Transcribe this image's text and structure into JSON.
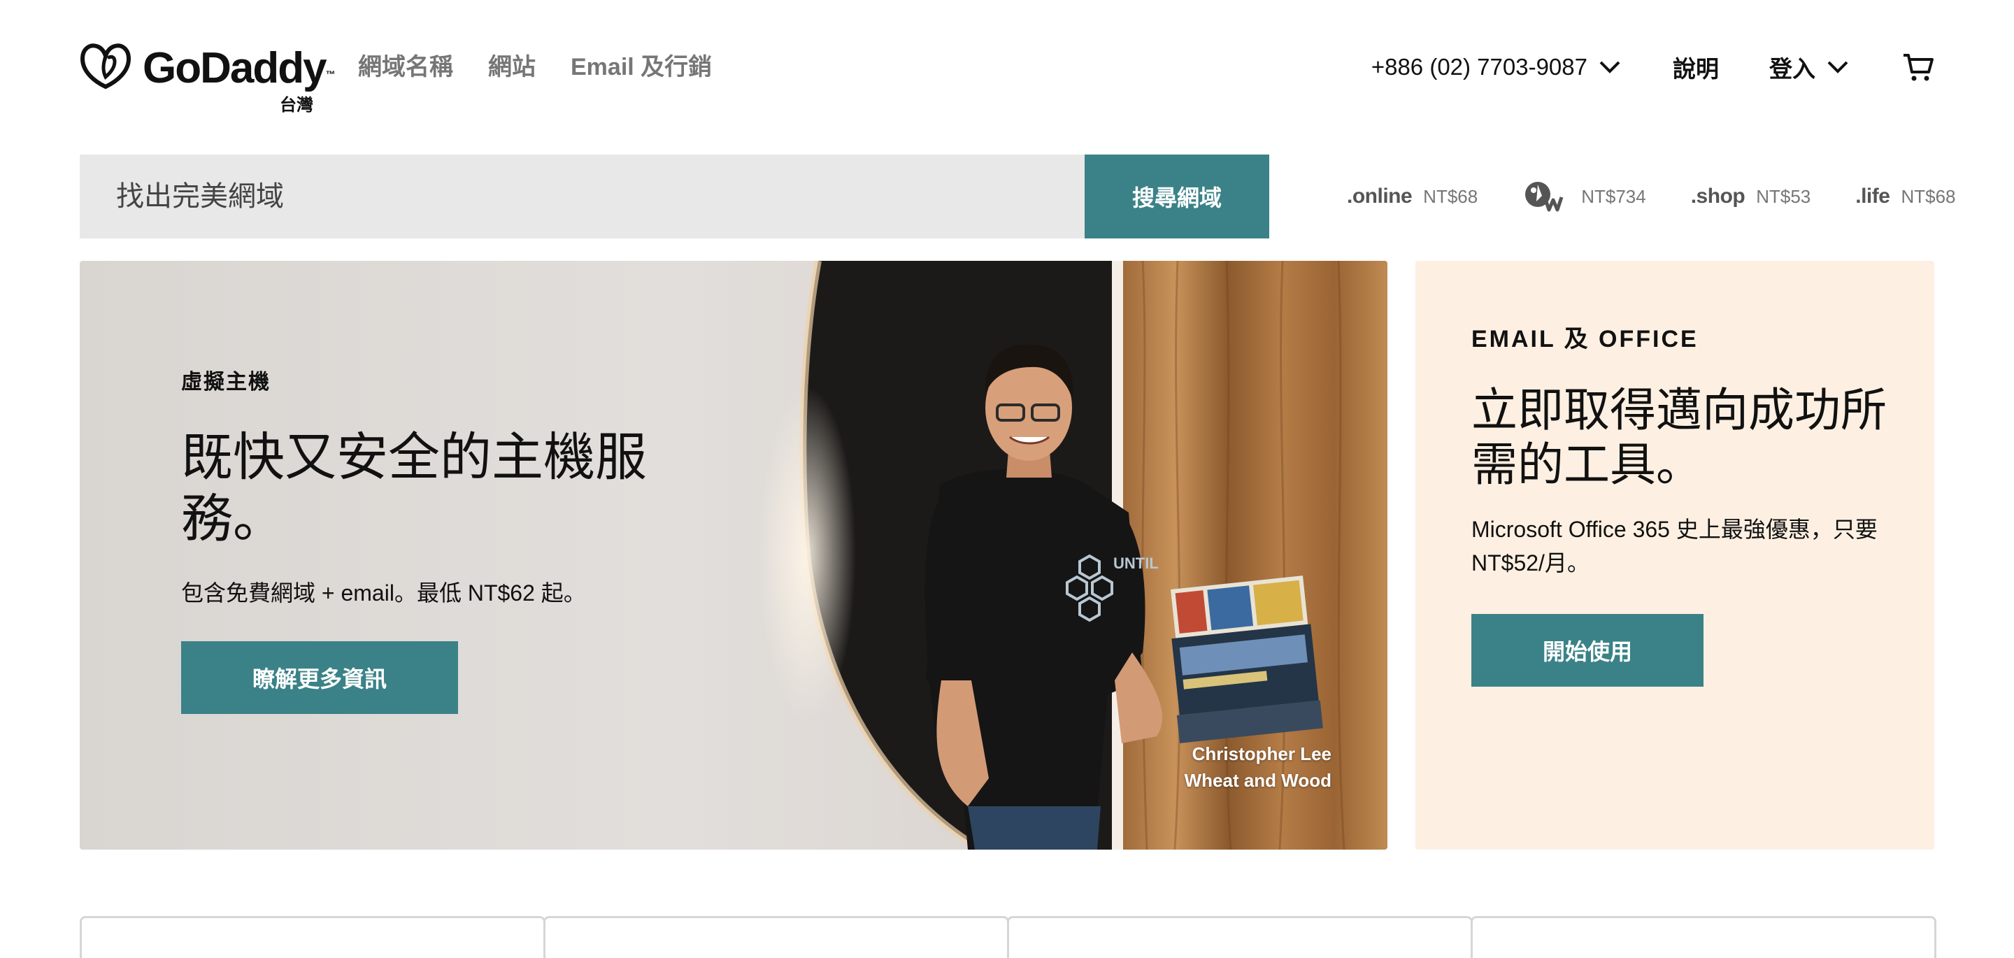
{
  "brand": {
    "name": "GoDaddy",
    "region": "台灣",
    "accent_color": "#3a8287"
  },
  "nav": {
    "items": [
      "網域名稱",
      "網站",
      "Email 及行銷"
    ]
  },
  "utility": {
    "phone": "+886 (02) 7703-9087",
    "help": "說明",
    "signin": "登入",
    "cart_icon": "cart-icon"
  },
  "search": {
    "placeholder": "找出完美網域",
    "button": "搜尋網域"
  },
  "tlds": [
    {
      "name": ".online",
      "price": "NT$68"
    },
    {
      "name": ".tw",
      "price": "NT$734"
    },
    {
      "name": ".shop",
      "price": "NT$53"
    },
    {
      "name": ".life",
      "price": "NT$68"
    }
  ],
  "hero": {
    "eyebrow": "虛擬主機",
    "title": "既快又安全的主機服務。",
    "body": "包含免費網域 + email。最低 NT$62 起。",
    "button": "瞭解更多資訊",
    "caption_name": "Christopher Lee",
    "caption_company": "Wheat and Wood"
  },
  "email_card": {
    "eyebrow": "EMAIL 及 OFFICE",
    "title": "立即取得邁向成功所需的工具。",
    "body": "Microsoft Office 365 史上最強優惠，只要 NT$52/月。",
    "button": "開始使用",
    "background": "#fdf0e2"
  }
}
